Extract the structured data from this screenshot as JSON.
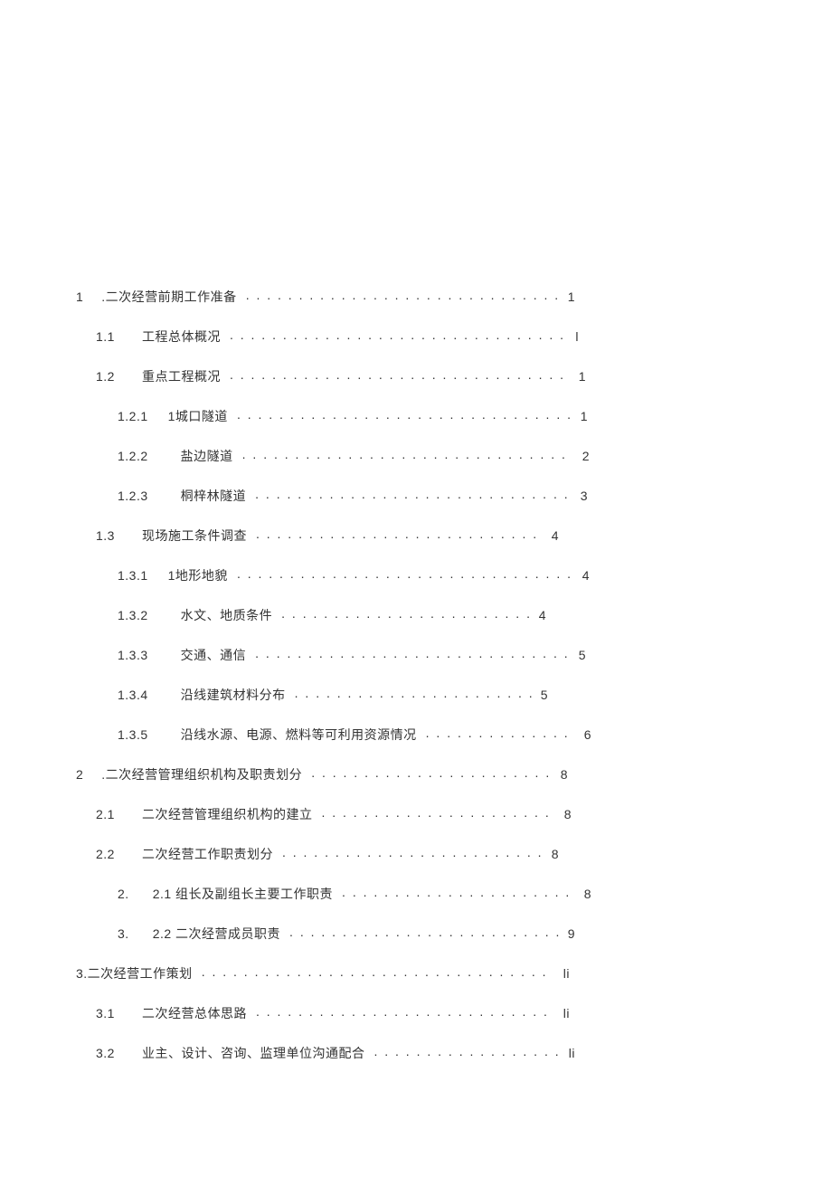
{
  "toc": [
    {
      "level": "lvl0",
      "num": "1",
      "text": ".二次经营前期工作准备",
      "page": "1",
      "textGap": "8px"
    },
    {
      "level": "lvl1",
      "num": "1.1",
      "text": "工程总体概况",
      "page": "l",
      "textGap": "18px"
    },
    {
      "level": "lvl1",
      "num": "1.2",
      "text": "重点工程概况",
      "page": "1",
      "textGap": "18px"
    },
    {
      "level": "lvl2",
      "num": "1.2.1",
      "text": "1城口隧道",
      "page": "1",
      "textGap": "10px"
    },
    {
      "level": "lvl2",
      "num": "1.2.2",
      "text": "盐边隧道",
      "page": "2",
      "textGap": "24px"
    },
    {
      "level": "lvl2",
      "num": "1.2.3",
      "text": "桐梓林隧道",
      "page": "3",
      "textGap": "24px"
    },
    {
      "level": "lvl1",
      "num": "1.3",
      "text": "现场施工条件调查",
      "page": "4",
      "textGap": "18px"
    },
    {
      "level": "lvl2",
      "num": "1.3.1",
      "text": "1地形地貌",
      "page": "4",
      "textGap": "10px"
    },
    {
      "level": "lvl2",
      "num": "1.3.2",
      "text": "水文、地质条件",
      "page": "4",
      "textGap": "24px"
    },
    {
      "level": "lvl2",
      "num": "1.3.3",
      "text": "交通、通信",
      "page": "5",
      "textGap": "24px"
    },
    {
      "level": "lvl2",
      "num": "1.3.4",
      "text": "沿线建筑材料分布",
      "page": "5",
      "textGap": "24px"
    },
    {
      "level": "lvl2",
      "num": "1.3.5",
      "text": "沿线水源、电源、燃料等可利用资源情况",
      "page": "6",
      "textGap": "24px"
    },
    {
      "level": "lvl0",
      "num": "2",
      "text": ".二次经营管理组织机构及职责划分",
      "page": "8",
      "textGap": "8px"
    },
    {
      "level": "lvl1",
      "num": "2.1",
      "text": "二次经营管理组织机构的建立",
      "page": "8",
      "textGap": "18px"
    },
    {
      "level": "lvl1",
      "num": "2.2",
      "text": "二次经营工作职责划分",
      "page": "8",
      "textGap": "18px"
    },
    {
      "level": "lvl2b",
      "num": "2.",
      "text": "2.1 组长及副组长主要工作职责",
      "page": "8",
      "textGap": "14px"
    },
    {
      "level": "lvl2b",
      "num": "3.",
      "text": "2.2 二次经营成员职责",
      "page": "9",
      "textGap": "14px"
    },
    {
      "level": "lvl3-special",
      "num": "",
      "text": "3.二次经营工作策划",
      "page": "li",
      "textGap": "0px"
    },
    {
      "level": "lvl1",
      "num": "3.1",
      "text": "二次经营总体思路",
      "page": "li",
      "textGap": "18px"
    },
    {
      "level": "lvl1",
      "num": "3.2",
      "text": "业主、设计、咨询、监理单位沟通配合",
      "page": "li",
      "textGap": "18px"
    }
  ],
  "rightEdges": [
    636,
    640,
    648,
    650,
    652,
    650,
    618,
    652,
    604,
    648,
    606,
    654,
    628,
    632,
    618,
    654,
    636,
    630,
    630,
    636
  ]
}
